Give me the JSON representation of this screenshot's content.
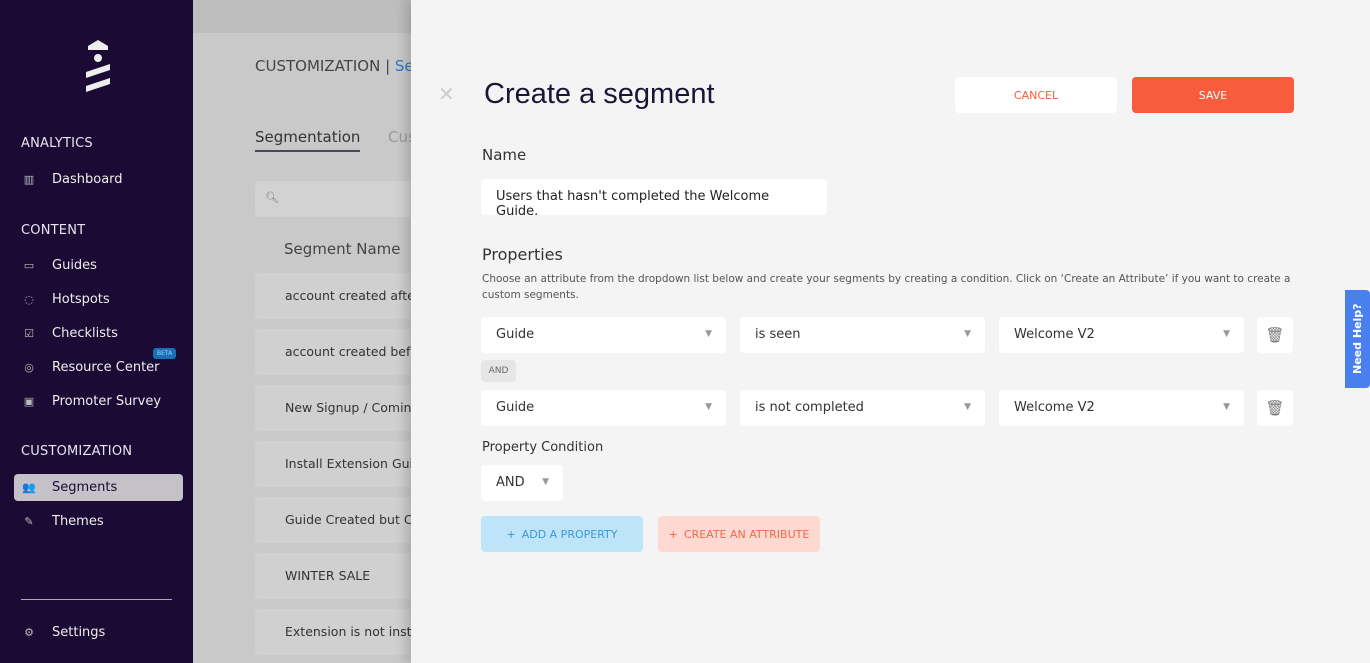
{
  "sidebar": {
    "sections": {
      "analytics": "ANALYTICS",
      "content": "CONTENT",
      "customization": "CUSTOMIZATION"
    },
    "items": [
      {
        "label": "Dashboard",
        "icon": "bar-chart-icon"
      },
      {
        "label": "Guides",
        "icon": "message-icon"
      },
      {
        "label": "Hotspots",
        "icon": "target-icon"
      },
      {
        "label": "Checklists",
        "icon": "checkbox-icon"
      },
      {
        "label": "Resource Center",
        "icon": "lifebuoy-icon",
        "badge": "BETA"
      },
      {
        "label": "Promoter Survey",
        "icon": "survey-icon"
      },
      {
        "label": "Segments",
        "icon": "users-icon",
        "active": true
      },
      {
        "label": "Themes",
        "icon": "brush-icon"
      },
      {
        "label": "Settings",
        "icon": "gear-icon"
      }
    ]
  },
  "background": {
    "breadcrumb": "CUSTOMIZATION |",
    "breadcrumb_current": "Se",
    "tabs": [
      "Segmentation",
      "Cus"
    ],
    "column_header": "Segment Name",
    "rows": [
      "account created afte",
      "account created befo",
      "New Signup / Coming",
      "Install Extension Gui",
      "Guide Created but Co",
      "WINTER SALE",
      "Extension is not insta"
    ]
  },
  "panel": {
    "title": "Create a segment",
    "cancel": "CANCEL",
    "save": "SAVE",
    "name_label": "Name",
    "name_value": "Users that hasn't completed the Welcome Guide.",
    "properties_label": "Properties",
    "properties_desc": "Choose an attribute from the dropdown list below and create your segments by creating a condition. Click on ‘Create an Attribute’ if you want to create a custom segments.",
    "conditions": [
      {
        "attribute": "Guide",
        "operator": "is seen",
        "value": "Welcome V2"
      },
      {
        "attribute": "Guide",
        "operator": "is not completed",
        "value": "Welcome V2"
      }
    ],
    "joiner": "AND",
    "property_condition_label": "Property Condition",
    "property_condition_value": "AND",
    "add_property": "ADD A PROPERTY",
    "create_attribute": "CREATE AN ATTRIBUTE"
  },
  "help_tab": "Need Help?",
  "colors": {
    "sidebar": "#1b0a33",
    "accent": "#f75c3c",
    "help": "#4a7ff0"
  }
}
